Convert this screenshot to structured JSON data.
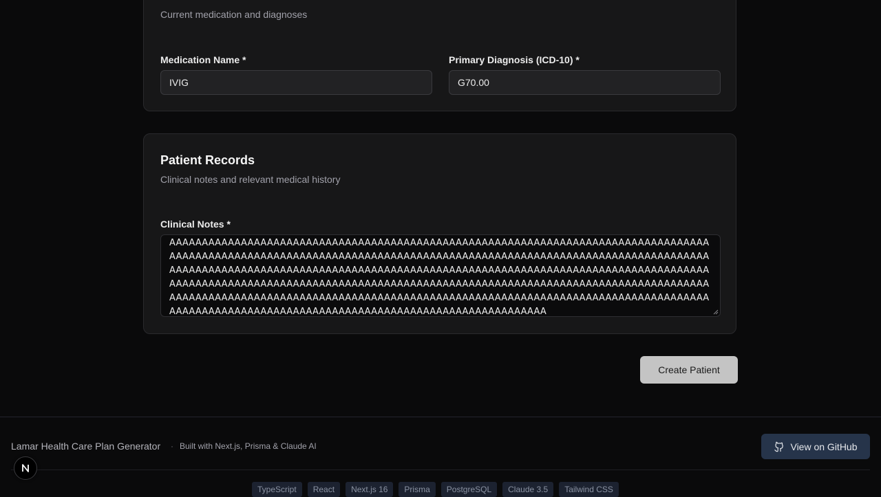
{
  "medication_card": {
    "description": "Current medication and diagnoses",
    "medication_label": "Medication Name *",
    "medication_value": "IVIG",
    "diagnosis_label": "Primary Diagnosis (ICD-10) *",
    "diagnosis_value": "G70.00"
  },
  "records_card": {
    "title": "Patient Records",
    "description": "Clinical notes and relevant medical history",
    "notes_label": "Clinical Notes *",
    "notes_value": "AAAAAAAAAAAAAAAAAAAAAAAAAAAAAAAAAAAAAAAAAAAAAAAAAAAAAAAAAAAAAAAAAAAAAAAAAAAAAAAAAAAAAAAAAAAAAAAAAAAAAAAAAAAAAAAAAAAAAAAAAAAAAAAAAAAAAAAAAAAAAAAAAAAAAAAAAAAAAAAAAAAAAAAAAAAAAAAAAAAAAAAAAAAAAAAAAAAAAAAAAAAAAAAAAAAAAAAAAAAAAAAAAAAAAAAAAAAAAAAAAAAAAAAAAAAAAAAAAAAAAAAAAAAAAAAAAAAAAAAAAAAAAAAAAAAAAAAAAAAAAAAAAAAAAAAAAAAAAAAAAAAAAAAAAAAAAAAAAAAAAAAAAAAAAAAAAAAAAAAAAAAAAAAAAAAAAAAAAAAAAAAAAAAAAAAAAAAAAAAAAAAAAAAAAAAAAAAAAAAAAAAAAAAAAAAAAAAAAAAAAAAAAAAAAAAAAAAAAAAAAAAAAAAAAAAAA"
  },
  "actions": {
    "create_label": "Create Patient"
  },
  "footer": {
    "title": "Lamar Health Care Plan Generator",
    "separator": "·",
    "built_with": "Built with Next.js, Prisma & Claude AI",
    "github_label": "View on GitHub",
    "tags": [
      "TypeScript",
      "React",
      "Next.js 16",
      "Prisma",
      "PostgreSQL",
      "Claude 3.5",
      "Tailwind CSS"
    ]
  },
  "colors": {
    "background": "#0a0a0b",
    "card": "#171718",
    "primary_button": "#c4c4c4",
    "github_button": "#26344a"
  },
  "icons": {
    "github": "github-icon",
    "next": "nextjs-logo-icon"
  }
}
